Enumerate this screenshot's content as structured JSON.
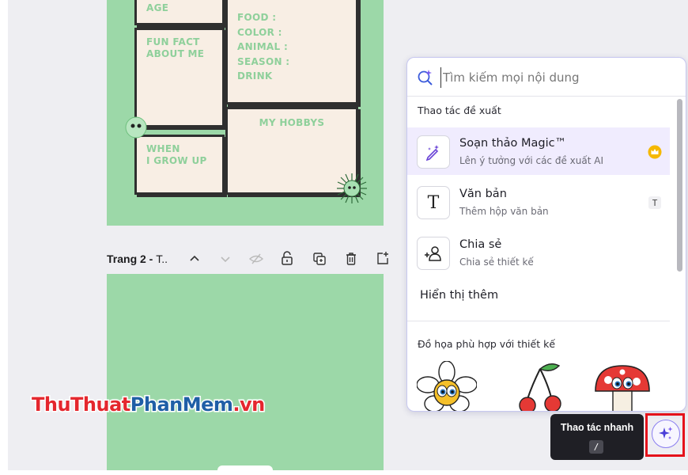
{
  "canvas": {
    "page1": {
      "labels": {
        "age": "AGE",
        "fun_fact": "FUN FACT\nABOUT ME",
        "favorites": "FOOD :\nCOLOR :\nANIMAL :\nSEASON :\nDRINK",
        "hobbies": "MY HOBBYS",
        "grow_up": "WHEN\nI GROW UP"
      }
    },
    "page_toolbar": {
      "title_bold": "Trang 2 - ",
      "title_rest": "T..",
      "icons": [
        "chevron-up-icon",
        "chevron-down-icon",
        "hide-icon",
        "lock-icon",
        "duplicate-icon",
        "delete-icon",
        "add-page-icon"
      ]
    }
  },
  "watermark": {
    "part1": "ThuThuat",
    "part2": "PhanMem",
    "part3": ".vn"
  },
  "panel": {
    "search": {
      "placeholder": "Tìm kiếm mọi nội dung",
      "value": ""
    },
    "section_suggested": "Thao tác đề xuất",
    "items": [
      {
        "title": "Soạn thảo Magic™",
        "subtitle": "Lên ý tưởng với các đề xuất AI",
        "icon": "magic-pen-icon",
        "badge": "crown-icon"
      },
      {
        "title": "Văn bản",
        "subtitle": "Thêm hộp văn bản",
        "icon": "text-icon",
        "shortcut": "T"
      },
      {
        "title": "Chia sẻ",
        "subtitle": "Chia sẻ thiết kế",
        "icon": "share-people-icon"
      }
    ],
    "show_more": "Hiển thị thêm",
    "section_graphics": "Đồ họa phù hợp với thiết kế",
    "graphics": [
      "flower-sticker",
      "cherry-sticker",
      "mushroom-sticker"
    ]
  },
  "tooltip": {
    "label": "Thao tác nhanh",
    "shortcut": "/"
  },
  "colors": {
    "page_green": "#9cd8a8",
    "accent_purple": "#7b5cf0",
    "highlight_red": "#e5121b",
    "crown_gold": "#f5b800"
  }
}
